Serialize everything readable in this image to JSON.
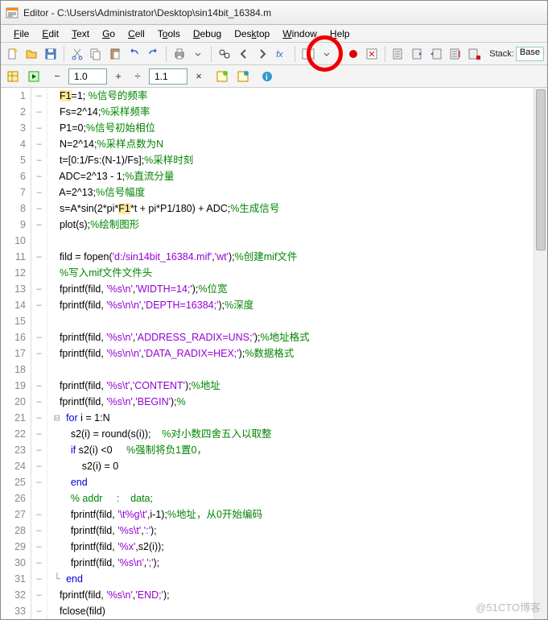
{
  "window": {
    "title": "Editor - C:\\Users\\Administrator\\Desktop\\sin14bit_16384.m"
  },
  "menu": {
    "file": "File",
    "edit": "Edit",
    "text": "Text",
    "go": "Go",
    "cell": "Cell",
    "tools": "Tools",
    "debug": "Debug",
    "desktop": "Desktop",
    "window": "Window",
    "help": "Help"
  },
  "toolbar": {
    "stack_label": "Stack:",
    "stack_value": "Base"
  },
  "toolbar2": {
    "val1": "1.0",
    "val2": "1.1"
  },
  "code": {
    "lines": [
      {
        "n": "1",
        "m": "–",
        "ind": 0,
        "seg": [
          [
            "",
            "F1=1; "
          ],
          [
            "cmt",
            "%信号的频率"
          ]
        ]
      },
      {
        "n": "2",
        "m": "–",
        "ind": 0,
        "seg": [
          [
            "",
            "Fs=2^14;"
          ],
          [
            "cmt",
            "%采样频率"
          ]
        ]
      },
      {
        "n": "3",
        "m": "–",
        "ind": 0,
        "seg": [
          [
            "",
            "P1=0;"
          ],
          [
            "cmt",
            "%信号初始相位"
          ]
        ]
      },
      {
        "n": "4",
        "m": "–",
        "ind": 0,
        "seg": [
          [
            "",
            "N=2^14;"
          ],
          [
            "cmt",
            "%采样点数为N"
          ]
        ]
      },
      {
        "n": "5",
        "m": "–",
        "ind": 0,
        "seg": [
          [
            "",
            "t=[0:1/Fs:(N-1)/Fs];"
          ],
          [
            "cmt",
            "%采样时刻"
          ]
        ]
      },
      {
        "n": "6",
        "m": "–",
        "ind": 0,
        "seg": [
          [
            "",
            "ADC=2^13 - 1;"
          ],
          [
            "cmt",
            "%直流分量"
          ]
        ]
      },
      {
        "n": "7",
        "m": "–",
        "ind": 0,
        "seg": [
          [
            "",
            "A=2^13;"
          ],
          [
            "cmt",
            "%信号幅度"
          ]
        ]
      },
      {
        "n": "8",
        "m": "–",
        "ind": 0,
        "seg": [
          [
            "",
            "s=A*sin(2*pi*"
          ],
          [
            "hl",
            "F1"
          ],
          [
            "",
            "*t + pi*P1/180) + ADC;"
          ],
          [
            "cmt",
            "%生成信号"
          ]
        ]
      },
      {
        "n": "9",
        "m": "–",
        "ind": 0,
        "seg": [
          [
            "",
            "plot(s);"
          ],
          [
            "cmt",
            "%绘制图形"
          ]
        ]
      },
      {
        "n": "10",
        "m": "",
        "ind": 0,
        "seg": []
      },
      {
        "n": "11",
        "m": "–",
        "ind": 0,
        "seg": [
          [
            "",
            "fild = fopen("
          ],
          [
            "str",
            "'d:/sin14bit_16384.mif'"
          ],
          [
            "",
            ","
          ],
          [
            "str",
            "'wt'"
          ],
          [
            "",
            ");"
          ],
          [
            "cmt",
            "%创建mif文件"
          ]
        ]
      },
      {
        "n": "12",
        "m": "",
        "ind": 0,
        "seg": [
          [
            "cmt",
            "%写入mif文件文件头"
          ]
        ]
      },
      {
        "n": "13",
        "m": "–",
        "ind": 0,
        "seg": [
          [
            "",
            "fprintf(fild, "
          ],
          [
            "str",
            "'%s\\n'"
          ],
          [
            "",
            ","
          ],
          [
            "str",
            "'WIDTH=14;'"
          ],
          [
            "",
            ");"
          ],
          [
            "cmt",
            "%位宽"
          ]
        ]
      },
      {
        "n": "14",
        "m": "–",
        "ind": 0,
        "seg": [
          [
            "",
            "fprintf(fild, "
          ],
          [
            "str",
            "'%s\\n\\n'"
          ],
          [
            "",
            ","
          ],
          [
            "str",
            "'DEPTH=16384;'"
          ],
          [
            "",
            ");"
          ],
          [
            "cmt",
            "%深度"
          ]
        ]
      },
      {
        "n": "15",
        "m": "",
        "ind": 0,
        "seg": []
      },
      {
        "n": "16",
        "m": "–",
        "ind": 0,
        "seg": [
          [
            "",
            "fprintf(fild, "
          ],
          [
            "str",
            "'%s\\n'"
          ],
          [
            "",
            ","
          ],
          [
            "str",
            "'ADDRESS_RADIX=UNS;'"
          ],
          [
            "",
            ");"
          ],
          [
            "cmt",
            "%地址格式"
          ]
        ]
      },
      {
        "n": "17",
        "m": "–",
        "ind": 0,
        "seg": [
          [
            "",
            "fprintf(fild, "
          ],
          [
            "str",
            "'%s\\n\\n'"
          ],
          [
            "",
            ","
          ],
          [
            "str",
            "'DATA_RADIX=HEX;'"
          ],
          [
            "",
            ");"
          ],
          [
            "cmt",
            "%数据格式"
          ]
        ]
      },
      {
        "n": "18",
        "m": "",
        "ind": 0,
        "seg": []
      },
      {
        "n": "19",
        "m": "–",
        "ind": 0,
        "seg": [
          [
            "",
            "fprintf(fild, "
          ],
          [
            "str",
            "'%s\\t'"
          ],
          [
            "",
            ","
          ],
          [
            "str",
            "'CONTENT'"
          ],
          [
            "",
            ");"
          ],
          [
            "cmt",
            "%地址"
          ]
        ]
      },
      {
        "n": "20",
        "m": "–",
        "ind": 0,
        "seg": [
          [
            "",
            "fprintf(fild, "
          ],
          [
            "str",
            "'%s\\n'"
          ],
          [
            "",
            ","
          ],
          [
            "str",
            "'BEGIN'"
          ],
          [
            "",
            ");"
          ],
          [
            "cmt",
            "%"
          ]
        ]
      },
      {
        "n": "21",
        "m": "–",
        "ind": 0,
        "fold": "⊟",
        "seg": [
          [
            "kw",
            "for"
          ],
          [
            "",
            " i = 1:N"
          ]
        ]
      },
      {
        "n": "22",
        "m": "–",
        "ind": 2,
        "seg": [
          [
            "",
            "s2(i) = round(s(i));    "
          ],
          [
            "cmt",
            "%对小数四舍五入以取整"
          ]
        ]
      },
      {
        "n": "23",
        "m": "–",
        "ind": 2,
        "seg": [
          [
            "kw",
            "if"
          ],
          [
            "",
            " s2(i) <0     "
          ],
          [
            "cmt",
            "%强制将负1置0，"
          ]
        ]
      },
      {
        "n": "24",
        "m": "–",
        "ind": 4,
        "seg": [
          [
            "",
            "s2(i) "
          ],
          [
            "hl",
            "="
          ],
          [
            "",
            " 0"
          ]
        ]
      },
      {
        "n": "25",
        "m": "–",
        "ind": 2,
        "seg": [
          [
            "kw",
            "end"
          ]
        ]
      },
      {
        "n": "26",
        "m": "",
        "ind": 2,
        "seg": [
          [
            "cmt",
            "% addr     :    data;"
          ]
        ]
      },
      {
        "n": "27",
        "m": "–",
        "ind": 2,
        "seg": [
          [
            "",
            "fprintf(fild, "
          ],
          [
            "str",
            "'\\t%g\\t'"
          ],
          [
            "",
            ",i-1);"
          ],
          [
            "cmt",
            "%地址，从0开始编码"
          ]
        ]
      },
      {
        "n": "28",
        "m": "–",
        "ind": 2,
        "seg": [
          [
            "",
            "fprintf(fild, "
          ],
          [
            "str",
            "'%s\\t'"
          ],
          [
            "",
            ","
          ],
          [
            "str",
            "':'"
          ],
          [
            "",
            ");"
          ]
        ]
      },
      {
        "n": "29",
        "m": "–",
        "ind": 2,
        "seg": [
          [
            "",
            "fprintf(fild, "
          ],
          [
            "str",
            "'%x'"
          ],
          [
            "",
            ",s2(i));"
          ]
        ]
      },
      {
        "n": "30",
        "m": "–",
        "ind": 2,
        "seg": [
          [
            "",
            "fprintf(fild, "
          ],
          [
            "str",
            "'%s\\n'"
          ],
          [
            "",
            ","
          ],
          [
            "str",
            "';'"
          ],
          [
            "",
            ");"
          ]
        ]
      },
      {
        "n": "31",
        "m": "–",
        "ind": 0,
        "fold": "└",
        "seg": [
          [
            "kw",
            "end"
          ]
        ]
      },
      {
        "n": "32",
        "m": "–",
        "ind": 0,
        "seg": [
          [
            "",
            "fprintf(fild, "
          ],
          [
            "str",
            "'%s\\n'"
          ],
          [
            "",
            ","
          ],
          [
            "str",
            "'END;'"
          ],
          [
            "",
            ");"
          ]
        ]
      },
      {
        "n": "33",
        "m": "–",
        "ind": 0,
        "seg": [
          [
            "",
            "fclose(fild)"
          ]
        ]
      }
    ]
  },
  "watermark": "@51CTO博客"
}
